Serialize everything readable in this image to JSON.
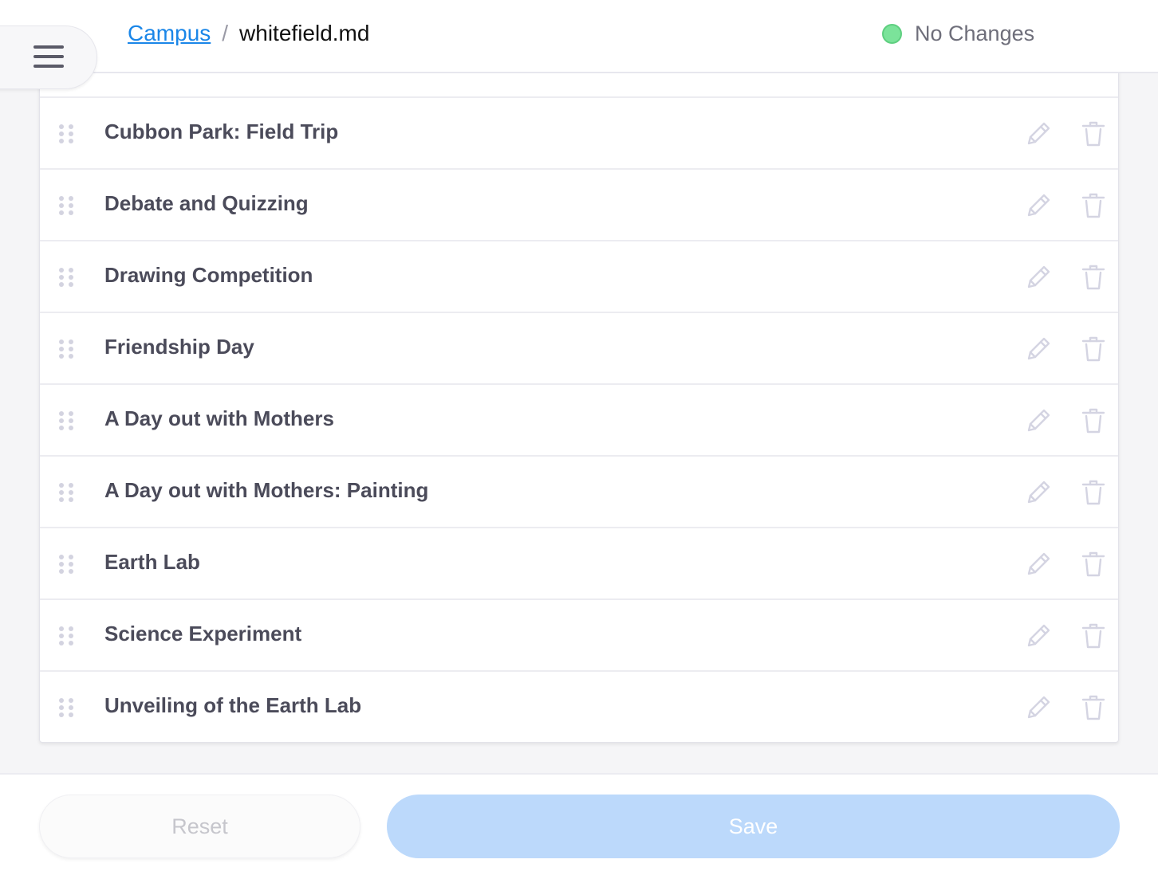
{
  "header": {
    "menu_icon": "hamburger-menu-icon",
    "breadcrumb": {
      "link": "Campus",
      "separator": "/",
      "current": "whitefield.md"
    },
    "status": {
      "text": "No Changes",
      "dot_color": "#7be39a"
    }
  },
  "list": {
    "items": [
      {
        "label": "Cubbon Park: Field Trip"
      },
      {
        "label": "Debate and Quizzing"
      },
      {
        "label": "Drawing Competition"
      },
      {
        "label": "Friendship Day"
      },
      {
        "label": "A Day out with Mothers"
      },
      {
        "label": "A Day out with Mothers: Painting"
      },
      {
        "label": "Earth Lab"
      },
      {
        "label": "Science Experiment"
      },
      {
        "label": "Unveiling of the Earth Lab"
      }
    ],
    "item_icons": {
      "drag": "drag-handle-icon",
      "edit": "pencil-icon",
      "delete": "trash-icon"
    }
  },
  "footer": {
    "reset_label": "Reset",
    "save_label": "Save",
    "save_color": "#bcd9fb"
  }
}
